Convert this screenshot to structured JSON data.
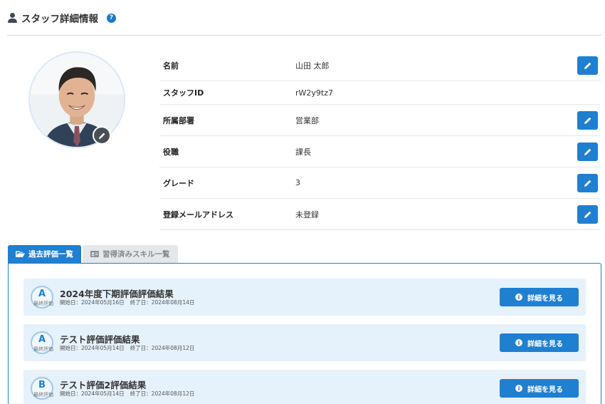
{
  "header": {
    "title": "スタッフ詳細情報",
    "help_glyph": "?"
  },
  "profile": {
    "avatar_alt": "staff photo"
  },
  "fields": [
    {
      "label": "名前",
      "value": "山田 太郎",
      "editable": true
    },
    {
      "label": "スタッフID",
      "value": "rW2y9tz7",
      "editable": false
    },
    {
      "label": "所属部署",
      "value": "営業部",
      "editable": true
    },
    {
      "label": "役職",
      "value": "課長",
      "editable": true
    },
    {
      "label": "グレード",
      "value": "3",
      "editable": true
    },
    {
      "label": "登録メールアドレス",
      "value": "未登録",
      "editable": true
    }
  ],
  "tabs": [
    {
      "label": "過去評価一覧",
      "icon": "folder-open-icon",
      "active": true
    },
    {
      "label": "習得済みスキル一覧",
      "icon": "id-card-icon",
      "active": false
    }
  ],
  "evaluations": [
    {
      "grade": "A",
      "grade_caption": "最終評価",
      "title": "2024年度下期評価評価結果",
      "start": "開始日：2024年05月16日",
      "end": "終了日：2024年08月14日",
      "button": "詳細を見る"
    },
    {
      "grade": "A",
      "grade_caption": "最終評価",
      "title": "テスト評価評価結果",
      "start": "開始日：2024年05月14日",
      "end": "終了日：2024年08月12日",
      "button": "詳細を見る"
    },
    {
      "grade": "B",
      "grade_caption": "最終評価",
      "title": "テスト評価2評価結果",
      "start": "開始日：2024年05月14日",
      "end": "終了日：2024年08月12日",
      "button": "詳細を見る"
    }
  ],
  "colors": {
    "primary": "#1f7fd0",
    "card_bg": "#e5f1fb",
    "tab_inactive": "#e6e7e9"
  }
}
